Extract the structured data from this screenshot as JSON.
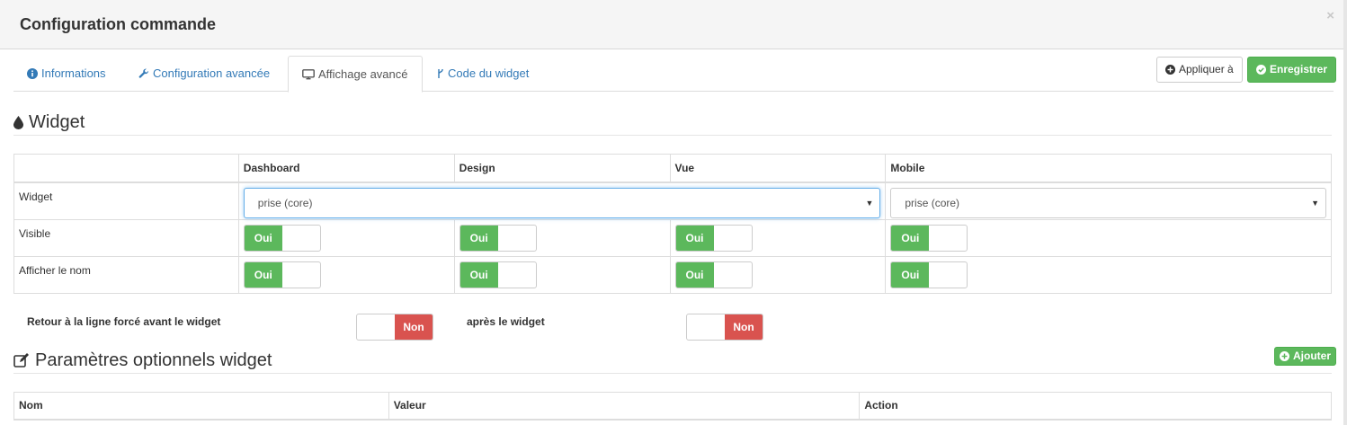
{
  "modal": {
    "title": "Configuration commande",
    "close": "×"
  },
  "tabs": [
    {
      "label": "Informations",
      "icon": "info-circle-icon"
    },
    {
      "label": "Configuration avancée",
      "icon": "wrench-icon"
    },
    {
      "label": "Affichage avancé",
      "icon": "desktop-icon",
      "active": true
    },
    {
      "label": "Code du widget",
      "icon": "code-fork-icon"
    }
  ],
  "actions": {
    "apply_label": "Appliquer à",
    "save_label": "Enregistrer"
  },
  "widget_section": {
    "title": "Widget",
    "columns": [
      "",
      "Dashboard",
      "Design",
      "Vue",
      "Mobile"
    ],
    "rows": {
      "widget": {
        "label": "Widget",
        "desktop_value": "prise (core)",
        "mobile_value": "prise (core)"
      },
      "visible": {
        "label": "Visible",
        "values": [
          "Oui",
          "Oui",
          "Oui",
          "Oui"
        ]
      },
      "show_name": {
        "label": "Afficher le nom",
        "values": [
          "Oui",
          "Oui",
          "Oui",
          "Oui"
        ]
      }
    },
    "line_break_before_label": "Retour à la ligne forcé avant le widget",
    "line_break_before_value": "Non",
    "line_break_after_label": "après le widget",
    "line_break_after_value": "Non"
  },
  "params_section": {
    "title": "Paramètres optionnels widget",
    "add_label": "Ajouter",
    "columns": [
      "Nom",
      "Valeur",
      "Action"
    ]
  },
  "colors": {
    "success": "#5cb85c",
    "danger": "#d9534f",
    "link": "#337ab7"
  }
}
